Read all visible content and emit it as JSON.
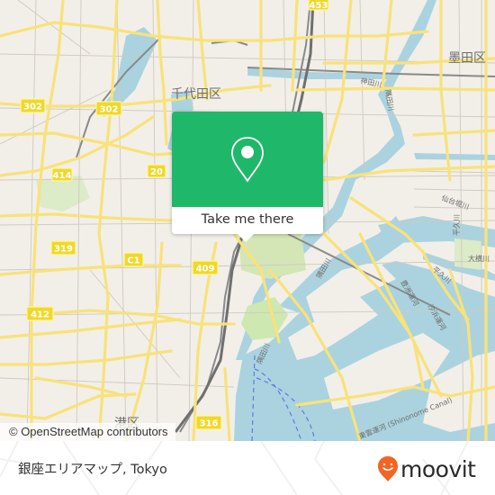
{
  "map": {
    "district_labels": [
      {
        "id": "chiyoda",
        "text": "千代田区"
      },
      {
        "id": "sumida",
        "text": "墨田区"
      },
      {
        "id": "minato",
        "text": "港区"
      }
    ],
    "water_labels": [
      {
        "id": "kanda",
        "text": "神田川"
      },
      {
        "id": "sumida1",
        "text": "隅田川"
      },
      {
        "id": "sumida2",
        "text": "隅田川"
      },
      {
        "id": "sumida3",
        "text": "隅田川"
      },
      {
        "id": "sendaibori",
        "text": "仙台堀川"
      },
      {
        "id": "heikyu1",
        "text": "平久川"
      },
      {
        "id": "heikyu2",
        "text": "平久川"
      },
      {
        "id": "oyoko",
        "text": "大横川"
      },
      {
        "id": "toyosu",
        "text": "豊洲運河"
      },
      {
        "id": "shiokaze",
        "text": "汐浜運河"
      },
      {
        "id": "shinonome",
        "text": "東雲運河 (Shinonome Canal)"
      }
    ],
    "road_shields": [
      {
        "id": "r453",
        "text": "453"
      },
      {
        "id": "r302a",
        "text": "302"
      },
      {
        "id": "r302b",
        "text": "302"
      },
      {
        "id": "r414",
        "text": "414"
      },
      {
        "id": "r20",
        "text": "20"
      },
      {
        "id": "r319",
        "text": "319"
      },
      {
        "id": "rC1",
        "text": "C1"
      },
      {
        "id": "r409",
        "text": "409"
      },
      {
        "id": "r412",
        "text": "412"
      },
      {
        "id": "r316",
        "text": "316"
      }
    ],
    "attribution": "© OpenStreetMap contributors"
  },
  "popup": {
    "icon": "map-pin-icon",
    "action_label": "Take me there",
    "accent_color": "#1fb86a"
  },
  "footer": {
    "place_name": "銀座エリアマップ, Tokyo",
    "brand_name": "moovit",
    "brand_color": "#f26522"
  }
}
